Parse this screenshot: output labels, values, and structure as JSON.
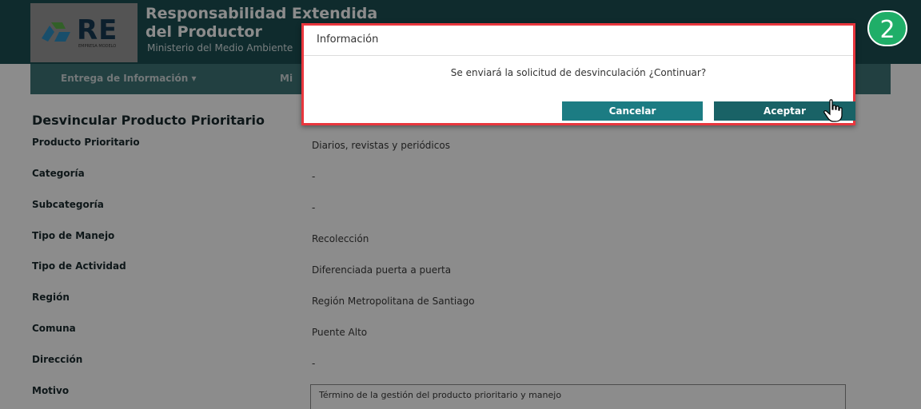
{
  "header": {
    "logo_text": "RE",
    "logo_sub": "EMPRESA MODELO",
    "title_line1": "Responsabilidad Extendida",
    "title_line2": "del Productor",
    "subtitle": "Ministerio del Medio Ambiente",
    "step_number": "2"
  },
  "nav": {
    "items": [
      {
        "label": "Entrega de Información ▾"
      },
      {
        "label": "Mi"
      }
    ]
  },
  "form": {
    "title": "Desvincular Producto Prioritario",
    "fields": [
      {
        "label": "Producto Prioritario",
        "value": "Diarios, revistas y periódicos"
      },
      {
        "label": "Categoría",
        "value": "-"
      },
      {
        "label": "Subcategoría",
        "value": "-"
      },
      {
        "label": "Tipo de Manejo",
        "value": "Recolección"
      },
      {
        "label": "Tipo de Actividad",
        "value": "Diferenciada puerta a puerta"
      },
      {
        "label": "Región",
        "value": "Región Metropolitana de Santiago"
      },
      {
        "label": "Comuna",
        "value": "Puente Alto"
      },
      {
        "label": "Dirección",
        "value": "-"
      },
      {
        "label": "Motivo",
        "value": "Término de la gestión del producto prioritario y manejo"
      }
    ]
  },
  "modal": {
    "title": "Información",
    "message": "Se enviará la solicitud de desvinculación ¿Continuar?",
    "cancel_label": "Cancelar",
    "accept_label": "Aceptar",
    "highlight_color": "#e8363d"
  },
  "colors": {
    "header_bg": "#1d4f52",
    "button_teal": "#1c7c83",
    "badge_green": "#1fae68"
  },
  "icons": [
    "recycle-logo-icon",
    "hand-pointer-cursor-icon"
  ]
}
